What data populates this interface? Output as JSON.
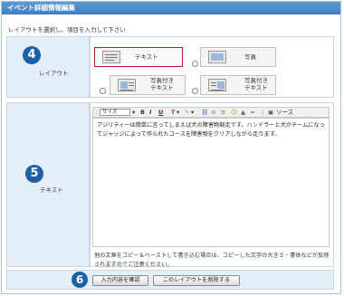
{
  "title": "イベント詳細情報編集",
  "instruction": "レイアウトを選択し、項目を入力して下さい",
  "layout_section": {
    "step": "4",
    "label": "レイアウト",
    "options": [
      {
        "label": "テキスト",
        "selected": true
      },
      {
        "label": "写真",
        "selected": false
      },
      {
        "label_line1": "写真付き",
        "label_line2": "テキスト",
        "selected": false
      },
      {
        "label_line1": "写真付き",
        "label_line2": "テキスト",
        "selected": false
      }
    ]
  },
  "text_section": {
    "step": "5",
    "label": "テキスト",
    "toolbar": {
      "size_label": "サイズ",
      "bold": "B",
      "italic": "I",
      "underline": "U",
      "source_label": "ソース"
    },
    "editor_content": "アジリティーは簡単に言ってしまえば犬の障害物競走です。ハンドラーと犬がチームになってジャッジによって作られたコースを障害物をクリアしながら走ります。",
    "note": "他の文章をコピー＆ペーストして書き込む場合は、コピーした文字の大きさ・書体などが反映されますのでご注意ください。"
  },
  "actions": {
    "step": "6",
    "confirm_label": "入力内容を確認",
    "delete_label": "このレイアウトを削除する"
  },
  "colors": {
    "title_bar": "#3f7fc0",
    "label_cell": "#e4eef8",
    "step_circle": "#1f5fa8",
    "selected_border": "#b02020"
  }
}
